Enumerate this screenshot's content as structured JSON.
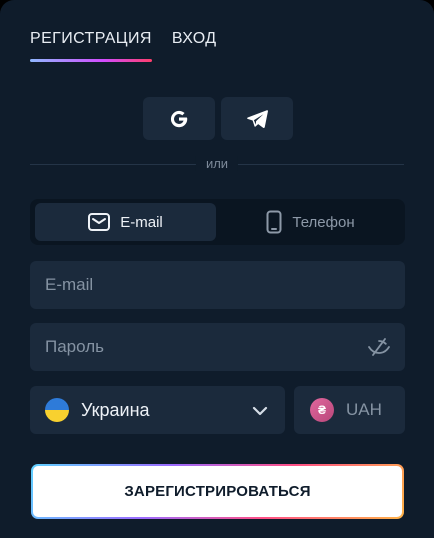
{
  "tabs": [
    {
      "label": "РЕГИСТРАЦИЯ",
      "active": true
    },
    {
      "label": "ВХОД",
      "active": false
    }
  ],
  "social": [
    {
      "icon": "google-icon"
    },
    {
      "icon": "telegram-icon"
    }
  ],
  "divider_text": "или",
  "method_switch": {
    "email_label": "E-mail",
    "phone_label": "Телефон",
    "selected": "email"
  },
  "form": {
    "email_placeholder": "E-mail",
    "password_placeholder": "Пароль",
    "country": "Украина",
    "currency": "UAH",
    "currency_symbol": "₴"
  },
  "register_button": "ЗАРЕГИСТРИРОВАТЬСЯ",
  "colors": {
    "panel_bg": "#0f1c2b",
    "field_bg": "#1b2a3c",
    "accent_gradient": [
      "#8fb8ff",
      "#d24cff",
      "#ff3e6b"
    ]
  }
}
